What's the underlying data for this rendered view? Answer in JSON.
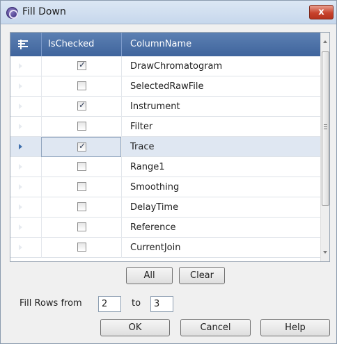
{
  "window": {
    "title": "Fill Down",
    "close_label": "x",
    "icon": "app-logo-icon"
  },
  "grid": {
    "columns": [
      "IsChecked",
      "ColumnName"
    ],
    "corner_icon": "filter-rows-icon",
    "selected_index": 4,
    "rows": [
      {
        "checked": true,
        "name": "DrawChromatogram"
      },
      {
        "checked": false,
        "name": "SelectedRawFile"
      },
      {
        "checked": true,
        "name": "Instrument"
      },
      {
        "checked": false,
        "name": "Filter"
      },
      {
        "checked": true,
        "name": "Trace"
      },
      {
        "checked": false,
        "name": "Range1"
      },
      {
        "checked": false,
        "name": "Smoothing"
      },
      {
        "checked": false,
        "name": "DelayTime"
      },
      {
        "checked": false,
        "name": "Reference"
      },
      {
        "checked": false,
        "name": "CurrentJoin"
      }
    ]
  },
  "actions": {
    "all_label": "All",
    "clear_label": "Clear"
  },
  "fill": {
    "label": "Fill Rows from",
    "from_value": "2",
    "to_label": "to",
    "to_value": "3"
  },
  "footer": {
    "ok_label": "OK",
    "cancel_label": "Cancel",
    "help_label": "Help"
  },
  "colors": {
    "header": "#4a6fa5",
    "selected_row": "#dfe7f2",
    "close_button": "#c8432d"
  }
}
